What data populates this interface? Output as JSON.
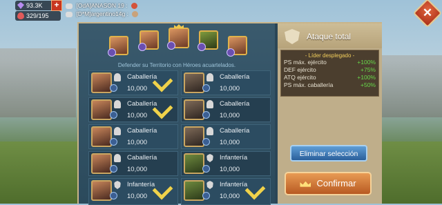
{
  "resources": {
    "gems": "93.3K",
    "hp": "329/195"
  },
  "chat": [
    {
      "text": "[OdA]ANASON 19 :"
    },
    {
      "text": "[D*M]argentino14g :"
    }
  ],
  "panel": {
    "defend_text": "Defender su Territorio con Héroes acuartelados.",
    "slots": [
      {
        "type": "Caballería",
        "count": "10,000",
        "checked": true
      },
      {
        "type": "Caballería",
        "count": "10,000",
        "checked": false
      },
      {
        "type": "Caballería",
        "count": "10,000",
        "checked": true
      },
      {
        "type": "Caballería",
        "count": "10,000",
        "checked": false
      },
      {
        "type": "Caballería",
        "count": "10,000",
        "checked": false
      },
      {
        "type": "Caballería",
        "count": "10,000",
        "checked": false
      },
      {
        "type": "Caballería",
        "count": "10,000",
        "checked": false
      },
      {
        "type": "Infantería",
        "count": "10,000",
        "checked": false
      },
      {
        "type": "Infantería",
        "count": "10,000",
        "checked": true
      },
      {
        "type": "Infantería",
        "count": "10,000",
        "checked": true
      }
    ]
  },
  "summary": {
    "title": "Ataque total",
    "leader_label": "- Líder desplegado -",
    "stats": [
      {
        "label": "PS máx. ejército",
        "value": "+100%"
      },
      {
        "label": "DEF ejército",
        "value": "+75%"
      },
      {
        "label": "ATQ ejército",
        "value": "+100%"
      },
      {
        "label": "PS máx. caballería",
        "value": "+50%"
      }
    ],
    "clear_button": "Eliminar selección",
    "confirm_button": "Confirmar"
  }
}
